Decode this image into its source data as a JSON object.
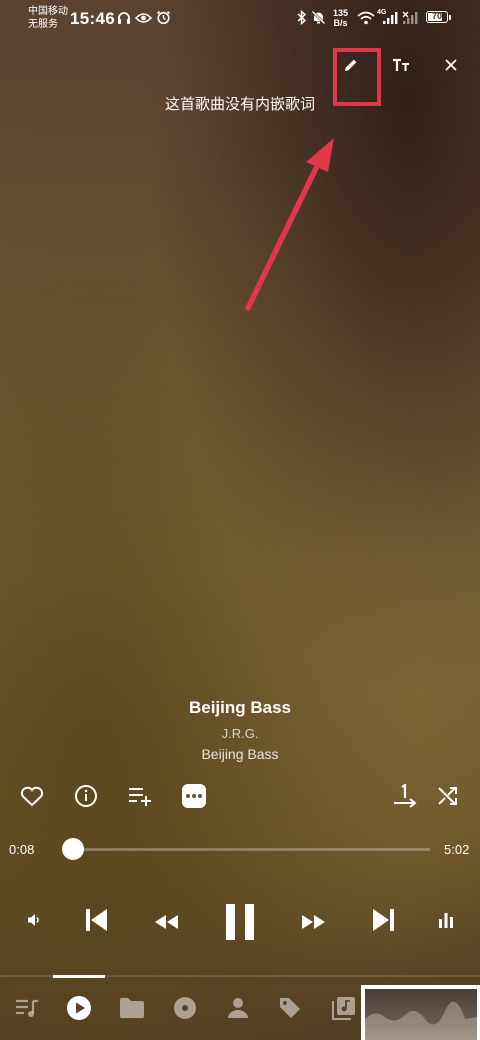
{
  "status_bar": {
    "carrier_line1": "中国移动",
    "carrier_line2": "无服务",
    "time": "15:46",
    "speed_value": "135",
    "speed_unit": "B/s",
    "network": "4G",
    "battery": "70",
    "battery_level": 0.7
  },
  "lyrics": {
    "empty_message": "这首歌曲没有内嵌歌词",
    "edit_icon": "pencil-icon",
    "text_size_icon": "text-size-icon",
    "close_icon": "close-icon"
  },
  "track": {
    "title": "Beijing Bass",
    "artist": "J.R.G.",
    "album": "Beijing Bass"
  },
  "actions": [
    "heart-icon",
    "info-icon",
    "add-to-queue-icon",
    "more-icon",
    "repeat-one-icon",
    "shuffle-icon"
  ],
  "progress": {
    "elapsed": "0:08",
    "total": "5:02",
    "fraction": 0.026
  },
  "playback": [
    "volume-icon",
    "previous-icon",
    "rewind-icon",
    "pause-icon",
    "fast-forward-icon",
    "next-icon",
    "equalizer-icon"
  ],
  "bottom_nav": [
    "playlist-icon",
    "now-playing-icon",
    "folder-icon",
    "album-icon",
    "artist-icon",
    "tag-icon",
    "music-library-icon"
  ],
  "colors": {
    "highlight": "#e2364a",
    "arrow": "#e2364a"
  }
}
